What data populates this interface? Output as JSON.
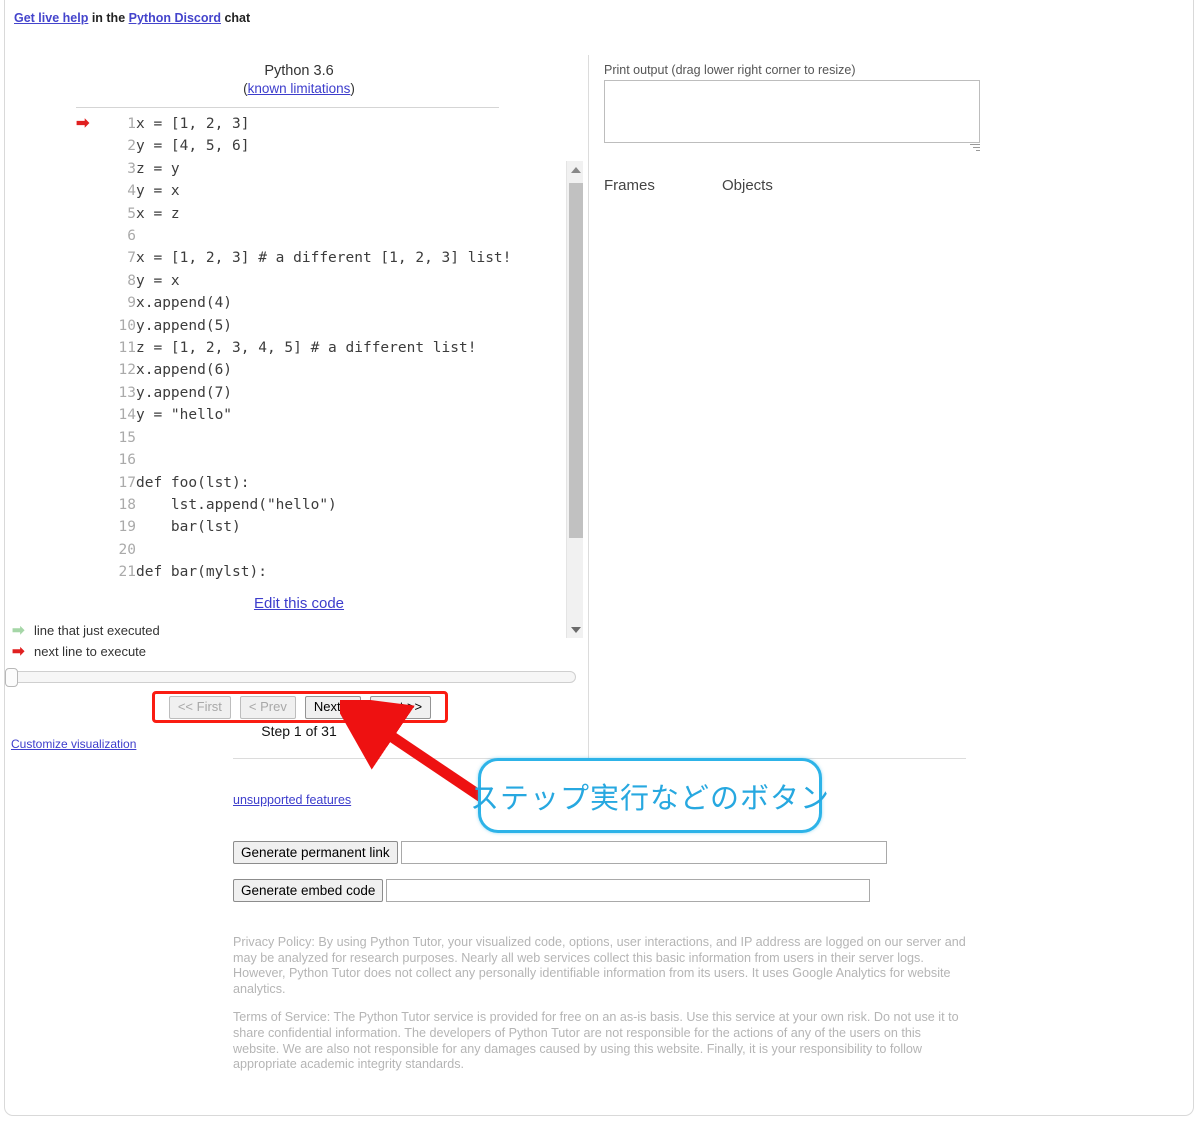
{
  "help_line": {
    "link1": "Get live help",
    "mid": " in the ",
    "link2": "Python Discord",
    "tail": " chat"
  },
  "code_panel": {
    "python_version": "Python 3.6",
    "limitations_prefix": "(",
    "limitations_link": "known limitations",
    "limitations_suffix": ")",
    "edit_link": "Edit this code",
    "lines": [
      {
        "num": "1",
        "text": "x = [1, 2, 3]",
        "arrow": "next"
      },
      {
        "num": "2",
        "text": "y = [4, 5, 6]",
        "arrow": ""
      },
      {
        "num": "3",
        "text": "z = y",
        "arrow": ""
      },
      {
        "num": "4",
        "text": "y = x",
        "arrow": ""
      },
      {
        "num": "5",
        "text": "x = z",
        "arrow": ""
      },
      {
        "num": "6",
        "text": "",
        "arrow": ""
      },
      {
        "num": "7",
        "text": "x = [1, 2, 3] # a different [1, 2, 3] list!",
        "arrow": ""
      },
      {
        "num": "8",
        "text": "y = x",
        "arrow": ""
      },
      {
        "num": "9",
        "text": "x.append(4)",
        "arrow": ""
      },
      {
        "num": "10",
        "text": "y.append(5)",
        "arrow": ""
      },
      {
        "num": "11",
        "text": "z = [1, 2, 3, 4, 5] # a different list!",
        "arrow": ""
      },
      {
        "num": "12",
        "text": "x.append(6)",
        "arrow": ""
      },
      {
        "num": "13",
        "text": "y.append(7)",
        "arrow": ""
      },
      {
        "num": "14",
        "text": "y = \"hello\"",
        "arrow": ""
      },
      {
        "num": "15",
        "text": "",
        "arrow": ""
      },
      {
        "num": "16",
        "text": "",
        "arrow": ""
      },
      {
        "num": "17",
        "text": "def foo(lst):",
        "arrow": ""
      },
      {
        "num": "18",
        "text": "    lst.append(\"hello\")",
        "arrow": ""
      },
      {
        "num": "19",
        "text": "    bar(lst)",
        "arrow": ""
      },
      {
        "num": "20",
        "text": "",
        "arrow": ""
      },
      {
        "num": "21",
        "text": "def bar(mylst):",
        "arrow": ""
      }
    ],
    "scrollbar": {
      "up_icon": "triangle-up-icon",
      "down_icon": "triangle-down-icon"
    }
  },
  "legend": {
    "executed_glyph": "➡",
    "executed_label": "line that just executed",
    "next_glyph": "➡",
    "next_label": "next line to execute",
    "executed_color": "#a5d6a7",
    "next_color": "#e02020"
  },
  "controls": {
    "first_label": "<< First",
    "prev_label": "< Prev",
    "next_label": "Next >",
    "last_label": "Last >>",
    "first_disabled": true,
    "prev_disabled": true,
    "step_label": "Step 1 of 31",
    "customize_link": "Customize visualization",
    "highlight_color": "#fa1c12"
  },
  "output_panel": {
    "print_output_label": "Print output (drag lower right corner to resize)",
    "print_output_value": "",
    "frames_header": "Frames",
    "objects_header": "Objects",
    "resize_handle": "resize-grip-icon"
  },
  "bottom": {
    "unsupported_link": "unsupported features",
    "generate_link_button": "Generate permanent link",
    "generate_link_value": "",
    "generate_embed_button": "Generate embed code",
    "generate_embed_value": "",
    "privacy": "Privacy Policy: By using Python Tutor, your visualized code, options, user interactions, and IP address are logged on our server and may be analyzed for research purposes. Nearly all web services collect this basic information from users in their server logs. However, Python Tutor does not collect any personally identifiable information from its users. It uses Google Analytics for website analytics.",
    "terms": "Terms of Service: The Python Tutor service is provided for free on an as-is basis. Use this service at your own risk. Do not use it to share confidential information. The developers of Python Tutor are not responsible for the actions of any of the users on this website. We are also not responsible for any damages caused by using this website. Finally, it is your responsibility to follow appropriate academic integrity standards."
  },
  "annotation": {
    "callout_text": "ステップ実行などのボタン",
    "callout_border_color": "#2db3e8",
    "callout_text_color": "#27a8e0",
    "arrow_color": "#ee1111"
  }
}
